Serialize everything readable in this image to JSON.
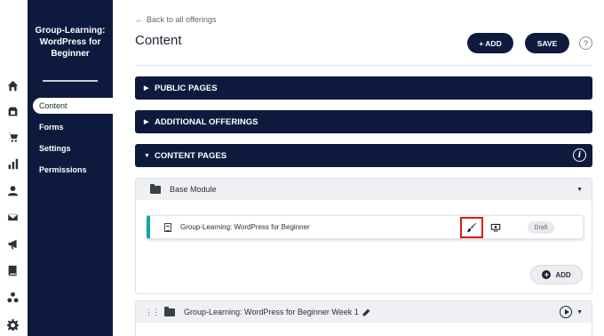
{
  "sidebar": {
    "title": "Group-Learning: WordPress for Beginner",
    "items": [
      {
        "label": "Content"
      },
      {
        "label": "Forms"
      },
      {
        "label": "Settings"
      },
      {
        "label": "Permissions"
      }
    ]
  },
  "rail_icons": [
    "home-icon",
    "store-icon",
    "cart-icon",
    "chart-icon",
    "user-icon",
    "mail-icon",
    "megaphone-icon",
    "book-icon",
    "community-icon",
    "gear-icon"
  ],
  "header": {
    "back_label": "Back to all offerings",
    "title": "Content",
    "add_label": "+ ADD",
    "save_label": "SAVE",
    "help_label": "?"
  },
  "sections": {
    "public_pages": "PUBLIC PAGES",
    "additional_offerings": "ADDITIONAL OFFERINGS",
    "content_pages": "CONTENT PAGES"
  },
  "module": {
    "name": "Base Module",
    "lesson": {
      "title": "Group-Learning: WordPress for Beginner",
      "status": "Draft"
    },
    "add_label": "ADD"
  },
  "module2": {
    "name": "Group-Learning: WordPress for Beginner Week 1"
  },
  "colors": {
    "navy": "#0e1a3d",
    "accent_teal": "#17a2b0",
    "highlight_red": "#e01818"
  }
}
